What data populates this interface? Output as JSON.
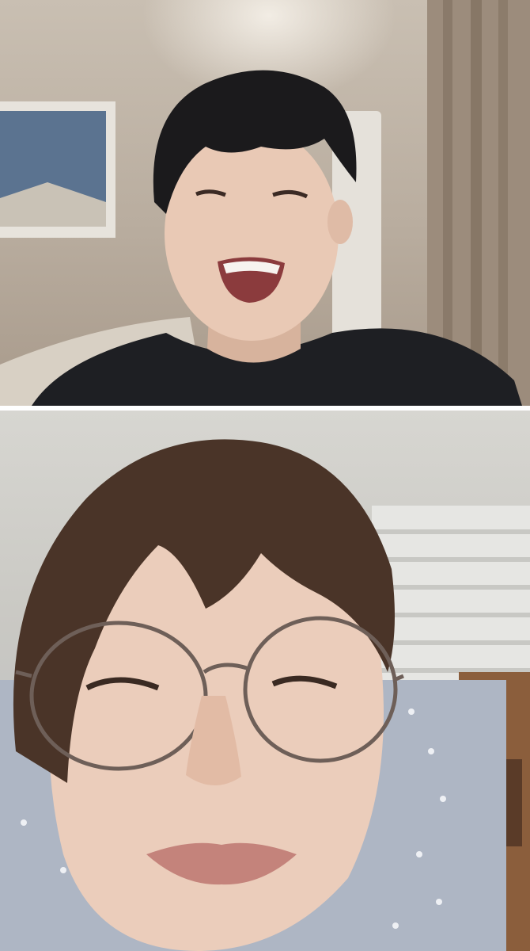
{
  "call": {
    "participants": [
      {
        "id": "host",
        "position": "top"
      },
      {
        "id": "guest",
        "position": "bottom"
      }
    ]
  },
  "colors": {
    "divider": "#ffffff",
    "top_wall": "#c4b9ac",
    "bottom_wall": "#d3d2cd",
    "shirt": "#1e1f23",
    "hair_dark": "#1b1a1c",
    "hair_brown": "#4a3428",
    "skin": "#e9c9b5",
    "pillow": "#aeb6c4"
  }
}
